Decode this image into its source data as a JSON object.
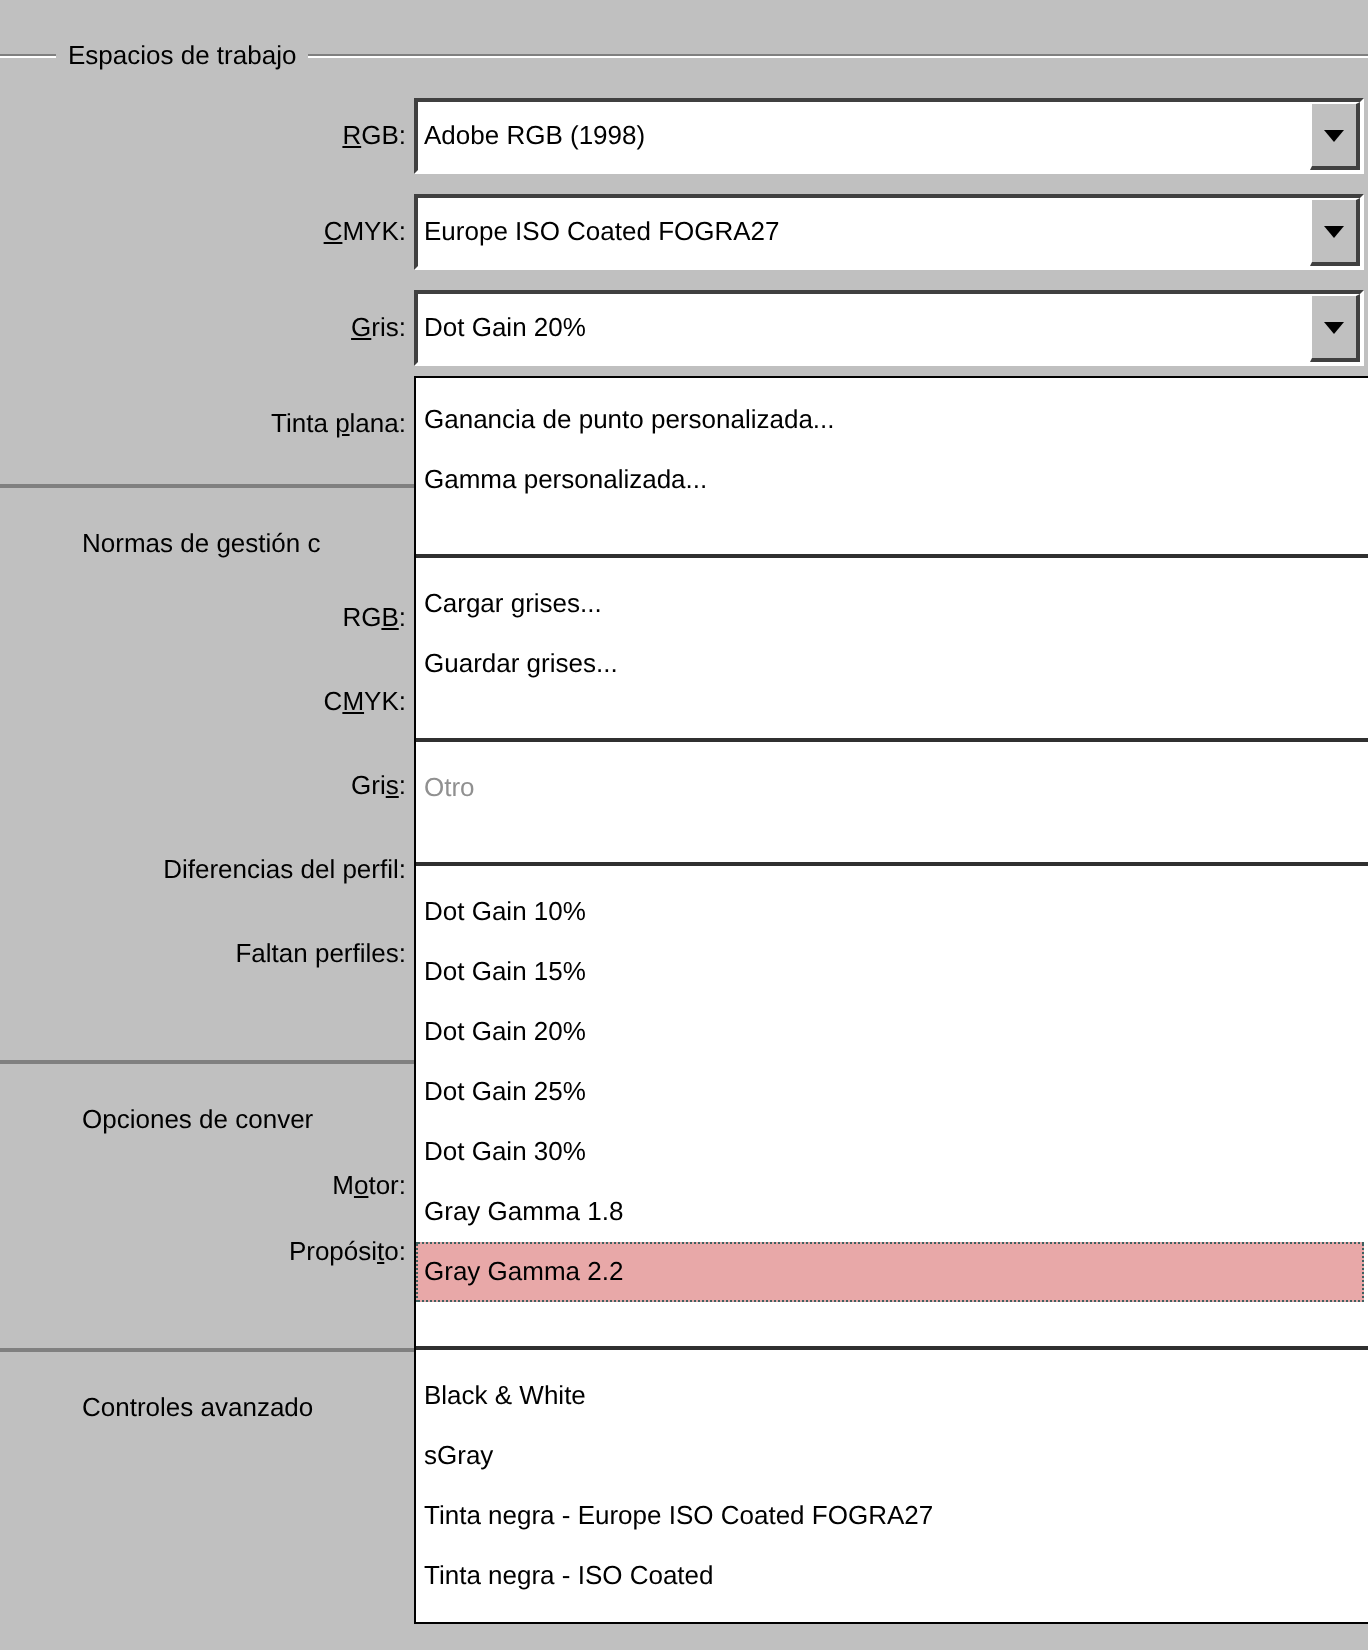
{
  "sections": [
    {
      "title": "Espacios de trabajo",
      "rows": [
        {
          "label": {
            "key": "R",
            "post": "GB:"
          },
          "combo": {
            "value": "Adobe RGB (1998)"
          }
        },
        {
          "label": {
            "key": "C",
            "post": "MYK:"
          },
          "combo": {
            "value": "Europe ISO Coated FOGRA27"
          }
        },
        {
          "label": {
            "key": "G",
            "post": "ris:"
          },
          "combo": {
            "value": "Dot Gain 20%"
          }
        },
        {
          "label": {
            "pre": "Tinta ",
            "key": "p",
            "post": "lana:"
          }
        }
      ]
    },
    {
      "title": "Normas de gestión c",
      "rows": [
        {
          "label": {
            "pre": "RG",
            "key": "B",
            "post": ":"
          }
        },
        {
          "label": {
            "pre": "C",
            "key": "M",
            "post": "YK:"
          }
        },
        {
          "label": {
            "pre": "Gri",
            "key": "s",
            "post": ":"
          }
        },
        {
          "label": {
            "pre": "Diferencias del perfil:"
          }
        },
        {
          "label": {
            "pre": "Faltan perfiles:"
          }
        }
      ]
    },
    {
      "title": "Opciones de conver",
      "rows": [
        {
          "label": {
            "pre": "M",
            "key": "o",
            "post": "tor:"
          }
        },
        {
          "label": {
            "pre": "Propósi",
            "key": "t",
            "post": "o:"
          }
        }
      ]
    },
    {
      "title": "Controles avanzado"
    }
  ],
  "dropdown_list": [
    {
      "kind": "item",
      "label": "Ganancia de punto personalizada...",
      "selected": false,
      "disabled": false
    },
    {
      "kind": "item",
      "label": "Gamma personalizada...",
      "selected": false,
      "disabled": false
    },
    {
      "kind": "separator"
    },
    {
      "kind": "item",
      "label": "Cargar grises...",
      "selected": false,
      "disabled": false
    },
    {
      "kind": "item",
      "label": "Guardar grises...",
      "selected": false,
      "disabled": false
    },
    {
      "kind": "separator"
    },
    {
      "kind": "item",
      "label": "Otro",
      "selected": false,
      "disabled": true
    },
    {
      "kind": "separator"
    },
    {
      "kind": "item",
      "label": "Dot Gain 10%",
      "selected": false,
      "disabled": false
    },
    {
      "kind": "item",
      "label": "Dot Gain 15%",
      "selected": false,
      "disabled": false
    },
    {
      "kind": "item",
      "label": "Dot Gain 20%",
      "selected": false,
      "disabled": false
    },
    {
      "kind": "item",
      "label": "Dot Gain 25%",
      "selected": false,
      "disabled": false
    },
    {
      "kind": "item",
      "label": "Dot Gain 30%",
      "selected": false,
      "disabled": false
    },
    {
      "kind": "item",
      "label": "Gray Gamma 1.8",
      "selected": false,
      "disabled": false
    },
    {
      "kind": "item",
      "label": "Gray Gamma 2.2",
      "selected": true,
      "disabled": false
    },
    {
      "kind": "separator"
    },
    {
      "kind": "item",
      "label": "Black & White",
      "selected": false,
      "disabled": false
    },
    {
      "kind": "item",
      "label": "sGray",
      "selected": false,
      "disabled": false
    },
    {
      "kind": "item",
      "label": "Tinta negra - Europe ISO Coated FOGRA27",
      "selected": false,
      "disabled": false
    },
    {
      "kind": "item",
      "label": "Tinta negra - ISO Coated",
      "selected": false,
      "disabled": false
    }
  ]
}
